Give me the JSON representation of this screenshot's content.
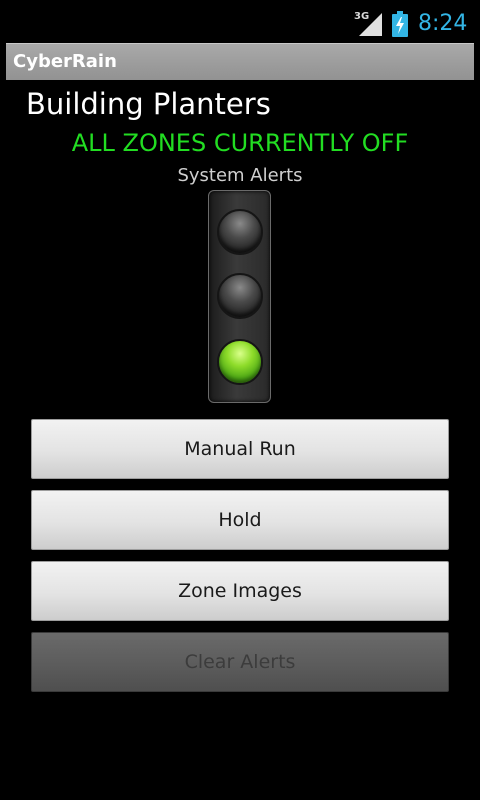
{
  "status_bar": {
    "network_type": "3G",
    "time": "8:24",
    "icons": [
      "signal-icon",
      "battery-charging-icon"
    ]
  },
  "app": {
    "title": "CyberRain"
  },
  "main": {
    "location_title": "Building Planters",
    "zones_status": "ALL ZONES CURRENTLY OFF",
    "alerts_label": "System Alerts",
    "traffic_light": {
      "state": "green",
      "lamps": [
        "off",
        "off",
        "on"
      ]
    },
    "buttons": {
      "manual_run": "Manual Run",
      "hold": "Hold",
      "zone_images": "Zone Images",
      "clear_alerts": "Clear Alerts"
    }
  },
  "colors": {
    "status_clock": "#33b5e5",
    "zones_status_text": "#22dd22",
    "green_lamp": "#8edc2a"
  }
}
